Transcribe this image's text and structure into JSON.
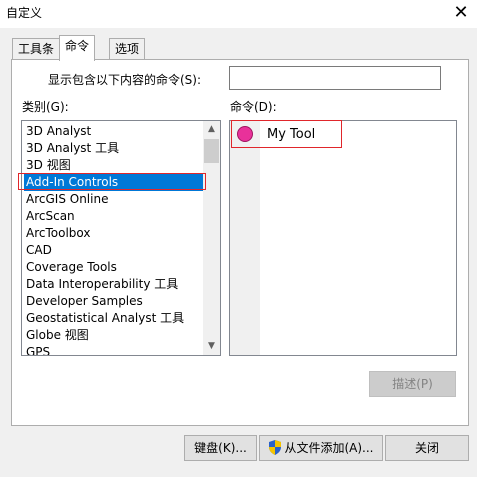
{
  "window": {
    "title": "自定义"
  },
  "tabs": [
    {
      "label": "工具条"
    },
    {
      "label": "命令"
    },
    {
      "label": "选项"
    }
  ],
  "filter": {
    "label": "显示包含以下内容的命令(S):",
    "value": ""
  },
  "categories": {
    "label": "类别(G):",
    "items": [
      "3D Analyst",
      "3D Analyst 工具",
      "3D 视图",
      "Add-In Controls",
      "ArcGIS Online",
      "ArcScan",
      "ArcToolbox",
      "CAD",
      "Coverage Tools",
      "Data Interoperability 工具",
      "Developer Samples",
      "Geostatistical Analyst 工具",
      "Globe 视图",
      "GPS"
    ],
    "selected": "Add-In Controls"
  },
  "commands": {
    "label": "命令(D):",
    "items": [
      {
        "label": "My Tool",
        "icon": "pink-circle-icon",
        "color": "#e8319a"
      }
    ]
  },
  "buttons": {
    "describe": "描述(P)",
    "keyboard": "键盘(K)...",
    "add_from_file": "从文件添加(A)...",
    "close": "关闭"
  },
  "colors": {
    "selection": "#0078d7",
    "highlight": "#e0262b"
  }
}
